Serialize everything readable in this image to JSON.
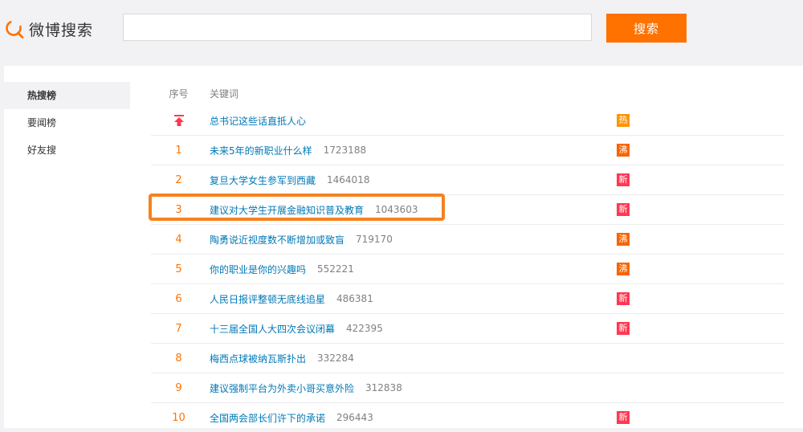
{
  "header": {
    "logo_text": "微博搜索",
    "search_value": "",
    "search_button": "搜索"
  },
  "sidebar": {
    "items": [
      {
        "label": "热搜榜",
        "active": true
      },
      {
        "label": "要闻榜",
        "active": false
      },
      {
        "label": "好友搜",
        "active": false
      }
    ]
  },
  "table": {
    "col_rank": "序号",
    "col_keyword": "关键词",
    "rows": [
      {
        "rank": "",
        "pinned": true,
        "keyword": "总书记这些话直抵人心",
        "count": "",
        "tag": "热",
        "tag_type": "re"
      },
      {
        "rank": "1",
        "keyword": "未来5年的新职业什么样",
        "count": "1723188",
        "tag": "沸",
        "tag_type": "fei"
      },
      {
        "rank": "2",
        "keyword": "复旦大学女生参军到西藏",
        "count": "1464018",
        "tag": "新",
        "tag_type": "xin"
      },
      {
        "rank": "3",
        "keyword": "建议对大学生开展金融知识普及教育",
        "count": "1043603",
        "tag": "新",
        "tag_type": "xin"
      },
      {
        "rank": "4",
        "keyword": "陶勇说近视度数不断增加或致盲",
        "count": "719170",
        "tag": "沸",
        "tag_type": "fei"
      },
      {
        "rank": "5",
        "keyword": "你的职业是你的兴趣吗",
        "count": "552221",
        "tag": "沸",
        "tag_type": "fei"
      },
      {
        "rank": "6",
        "keyword": "人民日报评整顿无底线追星",
        "count": "486381",
        "tag": "新",
        "tag_type": "xin"
      },
      {
        "rank": "7",
        "keyword": "十三届全国人大四次会议闭幕",
        "count": "422395",
        "tag": "新",
        "tag_type": "xin"
      },
      {
        "rank": "8",
        "keyword": "梅西点球被纳瓦斯扑出",
        "count": "332284",
        "tag": "",
        "tag_type": ""
      },
      {
        "rank": "9",
        "keyword": "建议强制平台为外卖小哥买意外险",
        "count": "312838",
        "tag": "",
        "tag_type": ""
      },
      {
        "rank": "10",
        "keyword": "全国两会部长们许下的承诺",
        "count": "296443",
        "tag": "新",
        "tag_type": "xin"
      }
    ]
  },
  "colors": {
    "accent": "#ff7200",
    "link": "#0078b6",
    "highlight": "#f58220",
    "tag_re": "#ff9406",
    "tag_fei": "#f86400",
    "tag_xin": "#ff3852"
  }
}
